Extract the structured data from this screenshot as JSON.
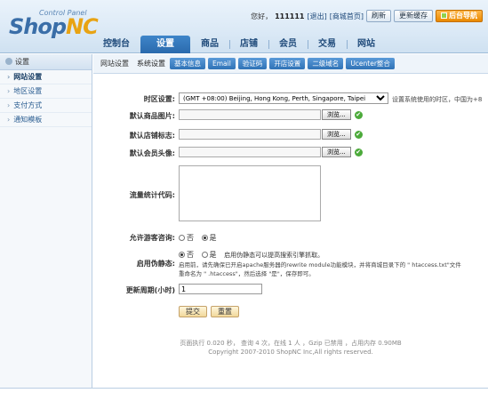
{
  "brand": {
    "logo_main": "Shop",
    "logo_accent": "NC",
    "logo_sub": "Control Panel"
  },
  "topbar": {
    "greeting": "您好，",
    "username": "111111",
    "logout": "[退出]",
    "shop_home": "[商城首页]",
    "refresh_label": "刷新",
    "update_cache_label": "更新缓存",
    "admin_nav_label": "后台导航"
  },
  "nav": {
    "items": [
      "控制台",
      "设置",
      "商品",
      "店铺",
      "会员",
      "交易",
      "网站"
    ],
    "active": "设置"
  },
  "sidebar": {
    "header": "设置",
    "items": [
      "网站设置",
      "地区设置",
      "支付方式",
      "通知模板"
    ],
    "active": "网站设置"
  },
  "subtabs": {
    "breadcrumb": "网站设置",
    "current": "系统设置",
    "tabs": [
      "基本信息",
      "Email",
      "验证码",
      "开店设置",
      "二级域名",
      "Ucenter整合"
    ]
  },
  "form": {
    "timezone": {
      "label": "时区设置:",
      "value": "(GMT +08:00) Beijing, Hong Kong, Perth, Singapore, Taipei",
      "hint": "设置系统使用的时区，中国为+8"
    },
    "default_product_image": {
      "label": "默认商品图片:",
      "browse": "浏览..."
    },
    "default_store_logo": {
      "label": "默认店铺标志:",
      "browse": "浏览..."
    },
    "default_member_avatar": {
      "label": "默认会员头像:",
      "browse": "浏览..."
    },
    "stat_code": {
      "label": "流量统计代码:",
      "value": ""
    },
    "guest_consult": {
      "label": "允许游客咨询:",
      "options": [
        "否",
        "是"
      ],
      "selected": "是"
    },
    "pseudo_static": {
      "label": "启用伪静态:",
      "options": [
        "否",
        "是"
      ],
      "selected": "否",
      "hint1": "启用伪静态可以提高搜索引擎抓取。",
      "hint2": "启用前，请先确保已开启apache服务器的rewrite module功能模块，并将商城目录下的 \" htaccess.txt\"文件",
      "hint3": "重命名为 \" .htaccess\"，然后选择 \"是\"，保存即可。"
    },
    "update_cycle": {
      "label": "更新周期(小时)",
      "value": "1"
    },
    "submit_label": "提交",
    "reset_label": "重置"
  },
  "footer": {
    "stats": "页面执行 0.020 秒， 查询 4 次，在线 1 人 ，Gzip 已禁用 ，占用内存 0.90MB",
    "copyright": "Copyright 2007-2010 ShopNC Inc,All rights reserved."
  }
}
